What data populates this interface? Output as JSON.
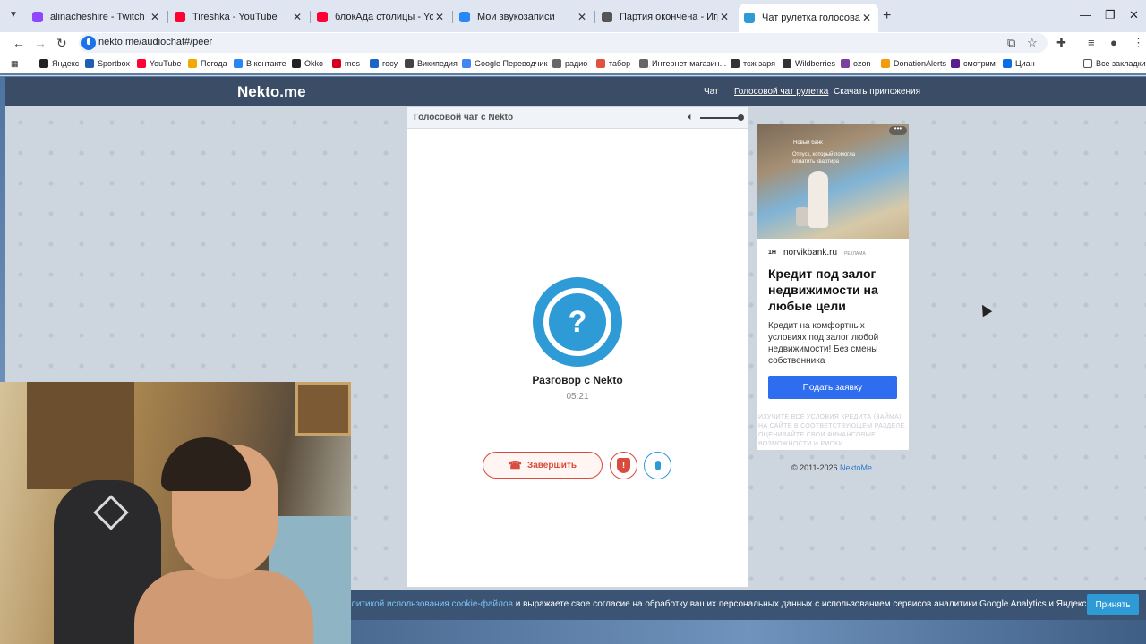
{
  "browser": {
    "tabs": [
      {
        "title": "alinacheshire - Twitch",
        "color": "#9146ff",
        "active": false
      },
      {
        "title": "Tireshka - YouTube",
        "color": "#ff0033",
        "active": false
      },
      {
        "title": "блокАда столицы - YouTube",
        "color": "#ff0033",
        "active": false
      },
      {
        "title": "Мои звукозаписи",
        "color": "#2787f5",
        "active": false
      },
      {
        "title": "Партия окончена - Игра iguan",
        "color": "#555555",
        "active": false
      },
      {
        "title": "Чат рулетка голосовая — ",
        "color": "#2e9bd6",
        "active": true
      }
    ],
    "url": "nekto.me/audiochat#/peer",
    "bookmarks": [
      {
        "label": "Яндекс",
        "color": "#222222"
      },
      {
        "label": "Sportbox",
        "color": "#1e5fb4"
      },
      {
        "label": "YouTube",
        "color": "#ff0033"
      },
      {
        "label": "Погода",
        "color": "#f2a900"
      },
      {
        "label": "В контакте",
        "color": "#2787f5"
      },
      {
        "label": "Okko",
        "color": "#222222"
      },
      {
        "label": "mos",
        "color": "#d6001c"
      },
      {
        "label": "госу",
        "color": "#1e64c8"
      },
      {
        "label": "Википедия",
        "color": "#444444"
      },
      {
        "label": "Google Переводчик",
        "color": "#4285f4"
      },
      {
        "label": "радио",
        "color": "#666666"
      },
      {
        "label": "табор",
        "color": "#e0523f"
      },
      {
        "label": "Интернет-магазин...",
        "color": "#666666"
      },
      {
        "label": "тсж заря",
        "color": "#333333"
      },
      {
        "label": "Wildberries",
        "color": "#333333"
      },
      {
        "label": "ozon",
        "color": "#7b3fa0"
      },
      {
        "label": "DonationAlerts",
        "color": "#f29b0c"
      },
      {
        "label": "смотрим",
        "color": "#5a1d8c"
      },
      {
        "label": "Циан",
        "color": "#0a6ee6"
      }
    ],
    "all_bookmarks": "Все закладки"
  },
  "site": {
    "logo": "Nekto.me",
    "nav": [
      "Чат",
      "Голосовой чат рулетка",
      "Скачать приложения"
    ]
  },
  "chat": {
    "header": "Голосовой чат с Nekto",
    "volume_level": 1.0,
    "avatar_glyph": "?",
    "title": "Разговор с Nekto",
    "time": "05:21",
    "end_label": "Завершить",
    "report_glyph": "!"
  },
  "ad": {
    "photo_line1": "Новый банк",
    "photo_line2": "Отпуск, который помогла оплатить квартира",
    "logo_badge": "1H",
    "domain": "norvikbank.ru",
    "label": "РЕКЛАМА",
    "headline": "Кредит под залог недвижимости на любые цели",
    "text": "Кредит на комфортных условиях под залог любой недвижимости! Без смены собственника",
    "cta": "Подать заявку",
    "disclaimer": "ИЗУЧИТЕ ВСЕ УСЛОВИЯ КРЕДИТА (ЗАЙМА) НА САЙТЕ В СООТВЕТСТВУЮЩЕМ РАЗДЕЛЕ. ОЦЕНИВАЙТЕ СВОИ ФИНАНСОВЫЕ ВОЗМОЖНОСТИ И РИСКИ"
  },
  "footer": {
    "copyright": "© 2011-2026 ",
    "brand": "NektoMe"
  },
  "cookie": {
    "link_text": "литикой использования cookie-файлов",
    "text": " и выражаете свое согласие на обработку ваших персональных данных с использованием сервисов аналитики Google Analytics и Яндекс Метрика.",
    "button": "Принять"
  }
}
